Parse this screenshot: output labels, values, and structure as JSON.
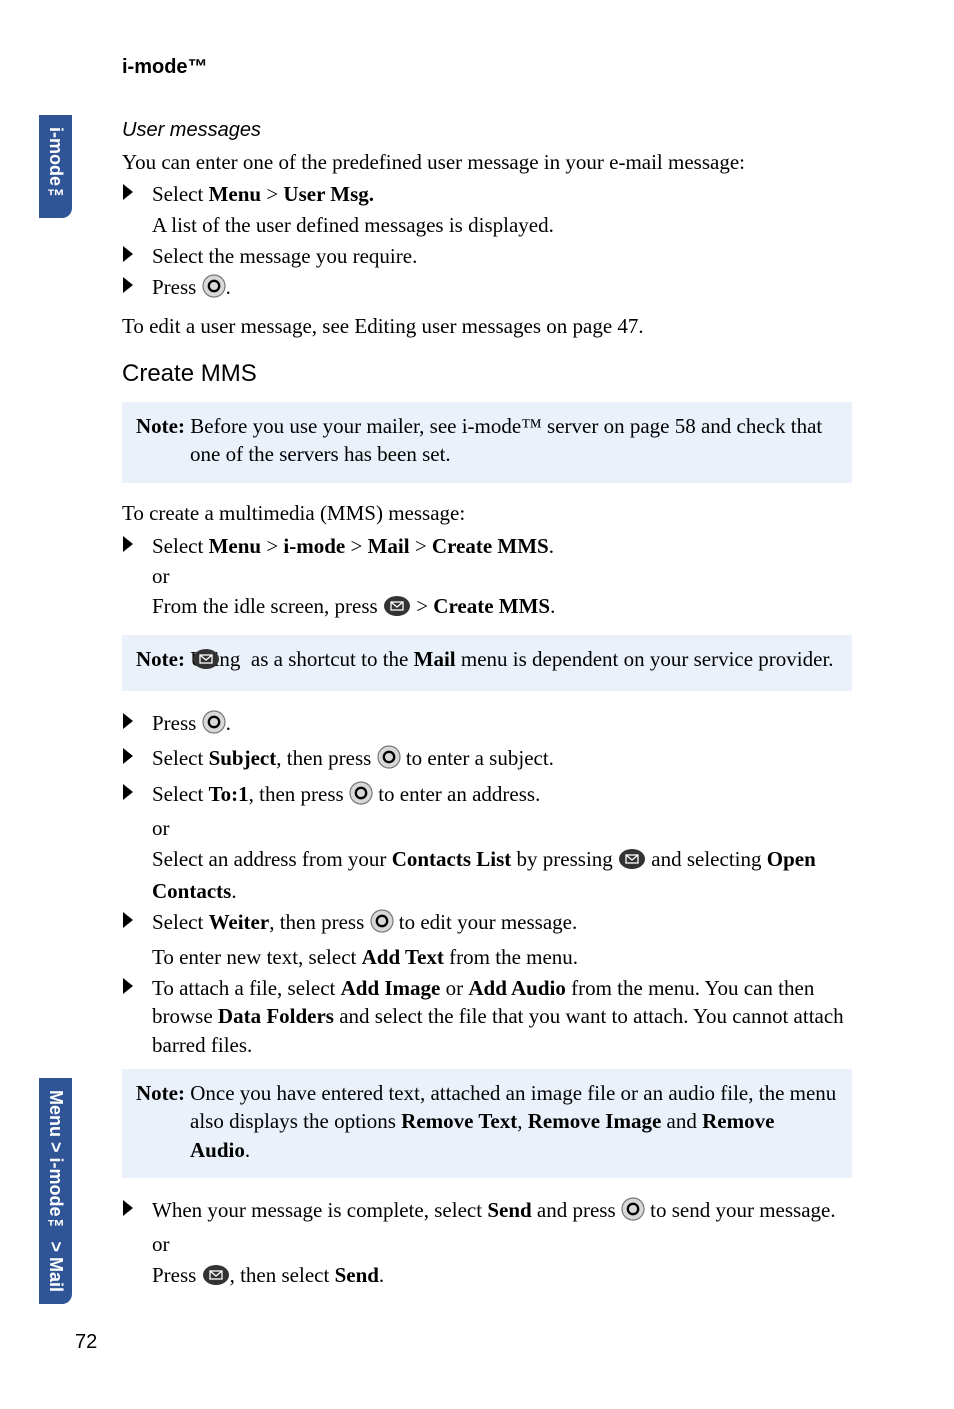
{
  "sidebar": {
    "tab_top": "i-mode™",
    "tab_bottom": "Menu > i-mode™ > Mail"
  },
  "header": {
    "chapter": "i-mode™"
  },
  "user_messages": {
    "heading": "User messages",
    "intro": "You can enter one of the predefined user message in your e-mail message:",
    "items": [
      {
        "text_prefix": "Select ",
        "bold1": "Menu",
        "mid": " > ",
        "bold2": "User Msg.",
        "subtext": "A list of the user defined messages is displayed."
      },
      {
        "text": "Select the message you require."
      },
      {
        "text_prefix": "Press ",
        "text_suffix": "."
      }
    ],
    "after": "To edit a user message, see Editing user messages on page 47."
  },
  "create_mms": {
    "heading": "Create MMS",
    "note1_label": "Note:",
    "note1_text": " Before you use your mailer, see i-mode™ server on page 58 and check that one of the servers has been set.",
    "intro": "To create a multimedia (MMS) message:",
    "step1": {
      "prefix": "Select ",
      "b1": "Menu",
      "sep1": " > ",
      "b2": "i-mode",
      "sep2": " > ",
      "b3": "Mail",
      "sep3": " > ",
      "b4": "Create MMS",
      "suffix": ".",
      "or": "or",
      "line2_prefix": "From the idle screen, press ",
      "line2_mid": " > ",
      "line2_bold": "Create MMS",
      "line2_suffix": "."
    },
    "note2_label": "Note:",
    "note2_prefix": " Using ",
    "note2_mid": " as a shortcut to the ",
    "note2_bold": "Mail",
    "note2_suffix": " menu is dependent on your service provider.",
    "steps2": {
      "press": {
        "prefix": "Press ",
        "suffix": "."
      },
      "subject": {
        "prefix": "Select ",
        "b1": "Subject",
        "mid": ", then press ",
        "suffix": " to enter a subject."
      },
      "to1": {
        "prefix": "Select ",
        "b1": "To:1",
        "mid": ", then press ",
        "suffix": " to enter an address.",
        "or": "or",
        "l2_prefix": "Select an address from your ",
        "l2_b1": "Contacts List",
        "l2_mid": " by pressing ",
        "l2_mid2": " and selecting ",
        "l2_b2": "Open Contacts",
        "l2_suffix": "."
      },
      "weiter": {
        "prefix": "Select ",
        "b1": "Weiter",
        "mid": ", then press ",
        "suffix": " to edit your message.",
        "l2_prefix": "To enter new text, select ",
        "l2_b1": "Add Text",
        "l2_suffix": " from the menu."
      },
      "attach": {
        "prefix": "To attach a file, select ",
        "b1": "Add Image",
        "mid1": " or ",
        "b2": "Add Audio",
        "mid2": " from the menu. You can then browse ",
        "b3": "Data Folders",
        "suffix": " and select the file that you want to attach. You cannot attach barred files."
      }
    },
    "note3_label": "Note:",
    "note3_prefix": " Once you have entered text, attached an image file or an audio file, the menu also displays the options ",
    "note3_b1": "Remove Text",
    "note3_sep1": ", ",
    "note3_b2": "Remove Image",
    "note3_sep2": " and ",
    "note3_b3": "Remove Audio",
    "note3_suffix": ".",
    "final": {
      "prefix": "When your message is complete, select ",
      "b1": "Send",
      "mid": " and press ",
      "suffix": " to send your message.",
      "or": "or",
      "l2_prefix": "Press ",
      "l2_mid": ", then select ",
      "l2_b1": "Send",
      "l2_suffix": "."
    }
  },
  "page_number": "72"
}
